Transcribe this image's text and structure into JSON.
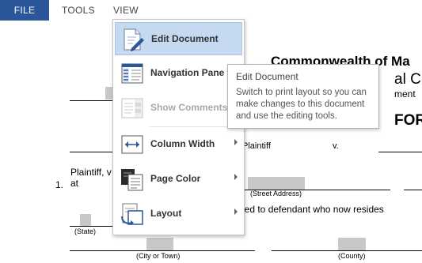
{
  "ribbon": {
    "tabs": [
      {
        "label": "FILE"
      },
      {
        "label": "TOOLS"
      },
      {
        "label": "VIEW"
      }
    ]
  },
  "document": {
    "heading_1": "Commonwealth of Ma",
    "heading_2": "al C",
    "heading_3": "ment",
    "heading_4": "FOR",
    "plaintiff": "Plaintiff",
    "versus": "v.",
    "plaintiff_v": "Plaintiff, v",
    "item_number": "1.",
    "at": "at",
    "street_address": "(Street Address)",
    "served_text": "ied to defendant who now resides",
    "state": "(State)",
    "city": "(City or Town)",
    "county": "(County)"
  },
  "view_menu": {
    "items": [
      {
        "label": "Edit Document",
        "icon": "edit-document-icon",
        "state": "highlighted"
      },
      {
        "label": "Navigation Pane",
        "icon": "navigation-pane-icon"
      },
      {
        "label": "Show Comments",
        "icon": "show-comments-icon",
        "state": "disabled"
      },
      {
        "label": "Column Width",
        "icon": "column-width-icon",
        "submenu": true
      },
      {
        "label": "Page Color",
        "icon": "page-color-icon",
        "submenu": true
      },
      {
        "label": "Layout",
        "icon": "layout-icon",
        "submenu": true
      }
    ]
  },
  "tooltip": {
    "title": "Edit Document",
    "body": "Switch to print layout so you can make changes to this document and use the editing tools."
  },
  "colors": {
    "file_tab": "#2b579a",
    "menu_highlight": "#c5d9f1",
    "icon_blue": "#2b579a"
  }
}
